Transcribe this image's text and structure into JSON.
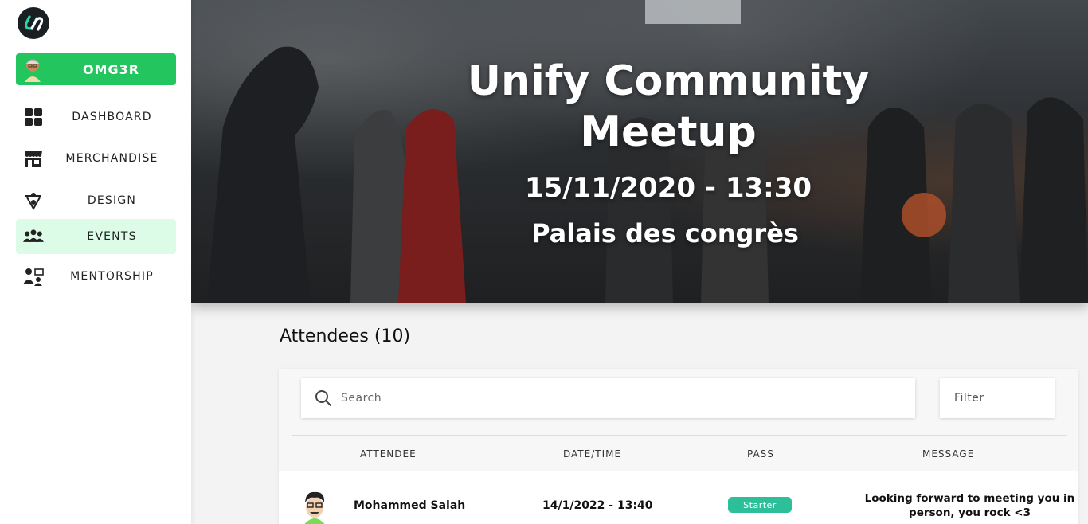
{
  "sidebar": {
    "user_name": "OMG3R",
    "items": [
      {
        "label": "DASHBOARD",
        "icon": "dashboard-icon"
      },
      {
        "label": "MERCHANDISE",
        "icon": "store-icon"
      },
      {
        "label": "DESIGN",
        "icon": "design-icon"
      },
      {
        "label": "EVENTS",
        "icon": "group-icon",
        "active": true
      },
      {
        "label": "MENTORSHIP",
        "icon": "mentorship-icon"
      }
    ]
  },
  "hero": {
    "title": "Unify Community Meetup",
    "datetime": "15/11/2020 - 13:30",
    "venue": "Palais des congrès"
  },
  "attendees": {
    "heading": "Attendees (10)",
    "search_placeholder": "Search",
    "filter_label": "Filter",
    "columns": [
      "ATTENDEE",
      "DATE/TIME",
      "PASS",
      "MESSAGE"
    ],
    "rows": [
      {
        "name": "Mohammed Salah",
        "datetime": "14/1/2022 - 13:40",
        "pass": "Starter",
        "message": "Looking forward to meeting you in person, you rock <3"
      }
    ]
  },
  "colors": {
    "accent": "#22c55e",
    "active_bg": "#dcfce7",
    "badge": "#2cbf9a"
  }
}
